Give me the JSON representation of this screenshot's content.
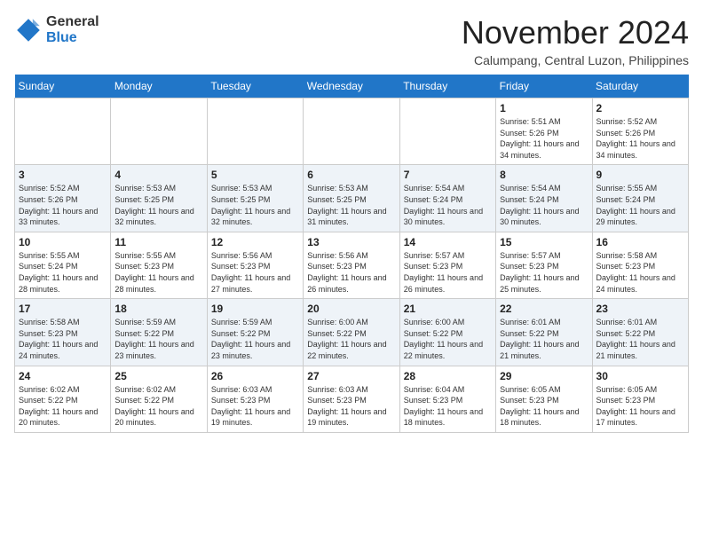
{
  "header": {
    "logo": {
      "general": "General",
      "blue": "Blue"
    },
    "title": "November 2024",
    "location": "Calumpang, Central Luzon, Philippines"
  },
  "calendar": {
    "weekdays": [
      "Sunday",
      "Monday",
      "Tuesday",
      "Wednesday",
      "Thursday",
      "Friday",
      "Saturday"
    ],
    "weeks": [
      [
        {
          "day": "",
          "sunrise": "",
          "sunset": "",
          "daylight": ""
        },
        {
          "day": "",
          "sunrise": "",
          "sunset": "",
          "daylight": ""
        },
        {
          "day": "",
          "sunrise": "",
          "sunset": "",
          "daylight": ""
        },
        {
          "day": "",
          "sunrise": "",
          "sunset": "",
          "daylight": ""
        },
        {
          "day": "",
          "sunrise": "",
          "sunset": "",
          "daylight": ""
        },
        {
          "day": "1",
          "sunrise": "Sunrise: 5:51 AM",
          "sunset": "Sunset: 5:26 PM",
          "daylight": "Daylight: 11 hours and 34 minutes."
        },
        {
          "day": "2",
          "sunrise": "Sunrise: 5:52 AM",
          "sunset": "Sunset: 5:26 PM",
          "daylight": "Daylight: 11 hours and 34 minutes."
        }
      ],
      [
        {
          "day": "3",
          "sunrise": "Sunrise: 5:52 AM",
          "sunset": "Sunset: 5:26 PM",
          "daylight": "Daylight: 11 hours and 33 minutes."
        },
        {
          "day": "4",
          "sunrise": "Sunrise: 5:53 AM",
          "sunset": "Sunset: 5:25 PM",
          "daylight": "Daylight: 11 hours and 32 minutes."
        },
        {
          "day": "5",
          "sunrise": "Sunrise: 5:53 AM",
          "sunset": "Sunset: 5:25 PM",
          "daylight": "Daylight: 11 hours and 32 minutes."
        },
        {
          "day": "6",
          "sunrise": "Sunrise: 5:53 AM",
          "sunset": "Sunset: 5:25 PM",
          "daylight": "Daylight: 11 hours and 31 minutes."
        },
        {
          "day": "7",
          "sunrise": "Sunrise: 5:54 AM",
          "sunset": "Sunset: 5:24 PM",
          "daylight": "Daylight: 11 hours and 30 minutes."
        },
        {
          "day": "8",
          "sunrise": "Sunrise: 5:54 AM",
          "sunset": "Sunset: 5:24 PM",
          "daylight": "Daylight: 11 hours and 30 minutes."
        },
        {
          "day": "9",
          "sunrise": "Sunrise: 5:55 AM",
          "sunset": "Sunset: 5:24 PM",
          "daylight": "Daylight: 11 hours and 29 minutes."
        }
      ],
      [
        {
          "day": "10",
          "sunrise": "Sunrise: 5:55 AM",
          "sunset": "Sunset: 5:24 PM",
          "daylight": "Daylight: 11 hours and 28 minutes."
        },
        {
          "day": "11",
          "sunrise": "Sunrise: 5:55 AM",
          "sunset": "Sunset: 5:23 PM",
          "daylight": "Daylight: 11 hours and 28 minutes."
        },
        {
          "day": "12",
          "sunrise": "Sunrise: 5:56 AM",
          "sunset": "Sunset: 5:23 PM",
          "daylight": "Daylight: 11 hours and 27 minutes."
        },
        {
          "day": "13",
          "sunrise": "Sunrise: 5:56 AM",
          "sunset": "Sunset: 5:23 PM",
          "daylight": "Daylight: 11 hours and 26 minutes."
        },
        {
          "day": "14",
          "sunrise": "Sunrise: 5:57 AM",
          "sunset": "Sunset: 5:23 PM",
          "daylight": "Daylight: 11 hours and 26 minutes."
        },
        {
          "day": "15",
          "sunrise": "Sunrise: 5:57 AM",
          "sunset": "Sunset: 5:23 PM",
          "daylight": "Daylight: 11 hours and 25 minutes."
        },
        {
          "day": "16",
          "sunrise": "Sunrise: 5:58 AM",
          "sunset": "Sunset: 5:23 PM",
          "daylight": "Daylight: 11 hours and 24 minutes."
        }
      ],
      [
        {
          "day": "17",
          "sunrise": "Sunrise: 5:58 AM",
          "sunset": "Sunset: 5:23 PM",
          "daylight": "Daylight: 11 hours and 24 minutes."
        },
        {
          "day": "18",
          "sunrise": "Sunrise: 5:59 AM",
          "sunset": "Sunset: 5:22 PM",
          "daylight": "Daylight: 11 hours and 23 minutes."
        },
        {
          "day": "19",
          "sunrise": "Sunrise: 5:59 AM",
          "sunset": "Sunset: 5:22 PM",
          "daylight": "Daylight: 11 hours and 23 minutes."
        },
        {
          "day": "20",
          "sunrise": "Sunrise: 6:00 AM",
          "sunset": "Sunset: 5:22 PM",
          "daylight": "Daylight: 11 hours and 22 minutes."
        },
        {
          "day": "21",
          "sunrise": "Sunrise: 6:00 AM",
          "sunset": "Sunset: 5:22 PM",
          "daylight": "Daylight: 11 hours and 22 minutes."
        },
        {
          "day": "22",
          "sunrise": "Sunrise: 6:01 AM",
          "sunset": "Sunset: 5:22 PM",
          "daylight": "Daylight: 11 hours and 21 minutes."
        },
        {
          "day": "23",
          "sunrise": "Sunrise: 6:01 AM",
          "sunset": "Sunset: 5:22 PM",
          "daylight": "Daylight: 11 hours and 21 minutes."
        }
      ],
      [
        {
          "day": "24",
          "sunrise": "Sunrise: 6:02 AM",
          "sunset": "Sunset: 5:22 PM",
          "daylight": "Daylight: 11 hours and 20 minutes."
        },
        {
          "day": "25",
          "sunrise": "Sunrise: 6:02 AM",
          "sunset": "Sunset: 5:22 PM",
          "daylight": "Daylight: 11 hours and 20 minutes."
        },
        {
          "day": "26",
          "sunrise": "Sunrise: 6:03 AM",
          "sunset": "Sunset: 5:23 PM",
          "daylight": "Daylight: 11 hours and 19 minutes."
        },
        {
          "day": "27",
          "sunrise": "Sunrise: 6:03 AM",
          "sunset": "Sunset: 5:23 PM",
          "daylight": "Daylight: 11 hours and 19 minutes."
        },
        {
          "day": "28",
          "sunrise": "Sunrise: 6:04 AM",
          "sunset": "Sunset: 5:23 PM",
          "daylight": "Daylight: 11 hours and 18 minutes."
        },
        {
          "day": "29",
          "sunrise": "Sunrise: 6:05 AM",
          "sunset": "Sunset: 5:23 PM",
          "daylight": "Daylight: 11 hours and 18 minutes."
        },
        {
          "day": "30",
          "sunrise": "Sunrise: 6:05 AM",
          "sunset": "Sunset: 5:23 PM",
          "daylight": "Daylight: 11 hours and 17 minutes."
        }
      ]
    ]
  }
}
